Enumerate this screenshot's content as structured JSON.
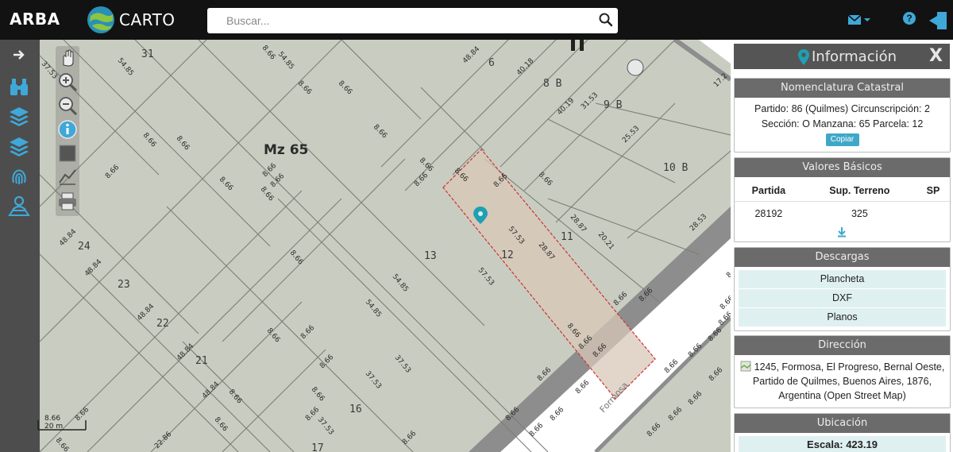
{
  "header": {
    "brand_arba": "ARBA",
    "brand_carto": "CARTO",
    "search_placeholder": "Buscar...",
    "accent_color": "#3fa8d8"
  },
  "map": {
    "manzana_label": "Mz 65",
    "street_label": "Formosa",
    "lots": [
      "31",
      "6",
      "8 B",
      "9 B",
      "10 B",
      "O",
      "24",
      "23",
      "22",
      "21",
      "13",
      "12",
      "11",
      "16",
      "17"
    ],
    "measures": [
      "37.53",
      "54.85",
      "8.66",
      "48.84",
      "40.18",
      "40.19",
      "31.53",
      "25.53",
      "8.66",
      "8.66",
      "8.66",
      "8.66",
      "8.66",
      "57.53",
      "28.87",
      "20.21",
      "28.53",
      "57.53",
      "54.85",
      "48.84",
      "48.84",
      "48.84",
      "48.84",
      "48.84",
      "54.85",
      "37.53",
      "37.53",
      "37.53",
      "8.66",
      "22.86",
      "28.87",
      "17.2",
      "54.85",
      "8.66",
      "8.66",
      "8.66",
      "8.66",
      "8.66",
      "8.66",
      "8.66",
      "8.66",
      "8.66",
      "8.66",
      "8.66",
      "8.66",
      "8.66",
      "8.66",
      "8.66",
      "8.66",
      "8.66",
      "8.66",
      "8.66",
      "8.66",
      "8.66",
      "8.66",
      "8.66",
      "8.66",
      "8.66",
      "8.66",
      "8.66",
      "8.66",
      "8.66",
      "8.66",
      "8.66",
      "8.66",
      "8.66",
      "8.66",
      "8.66",
      "8.66",
      "8.66",
      "8.66",
      "8.66",
      "8.66"
    ],
    "scale_left": "20 m",
    "scale_top": "8.66",
    "selected_color": "#cc3333",
    "marker_color": "#1f9fb2"
  },
  "panel": {
    "title": "Información",
    "close": "X",
    "nomenclatura": {
      "header": "Nomenclatura Catastral",
      "line1": "Partido: 86 (Quilmes) Circunscripción: 2",
      "line2": "Sección: O Manzana: 65 Parcela: 12",
      "copy_label": "Copiar"
    },
    "valores": {
      "header": "Valores Básicos",
      "columns": [
        "Partida",
        "Sup. Terreno",
        "SP"
      ],
      "rows": [
        [
          "28192",
          "325",
          ""
        ]
      ]
    },
    "descargas": {
      "header": "Descargas",
      "items": [
        "Plancheta",
        "DXF",
        "Planos"
      ]
    },
    "direccion": {
      "header": "Dirección",
      "text": "1245, Formosa, El Progreso, Bernal Oeste, Partido de Quilmes, Buenos Aires, 1876, Argentina (Open Street Map)"
    },
    "ubicacion": {
      "header": "Ubicación",
      "scale_label": "Escala: 423.19"
    }
  }
}
